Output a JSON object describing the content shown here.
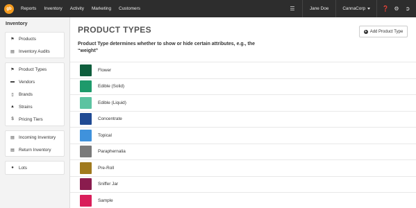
{
  "topnav": {
    "logo_text": "gb",
    "links": [
      "Reports",
      "Inventory",
      "Activity",
      "Marketing",
      "Customers"
    ],
    "user": "Jane Doe",
    "org": "CannaCorp"
  },
  "sidebar": {
    "title": "Inventory",
    "groups": [
      [
        {
          "label": "Products",
          "icon": "tag-icon"
        },
        {
          "label": "Inventory Audits",
          "icon": "clipboard-icon"
        }
      ],
      [
        {
          "label": "Product Types",
          "icon": "tags-icon"
        },
        {
          "label": "Vendors",
          "icon": "truck-icon"
        },
        {
          "label": "Brands",
          "icon": "bookmark-icon"
        },
        {
          "label": "Strains",
          "icon": "flask-icon"
        },
        {
          "label": "Pricing Tiers",
          "icon": "dollar-icon"
        }
      ],
      [
        {
          "label": "Incoming Inventory",
          "icon": "inbox-in-icon"
        },
        {
          "label": "Return Inventory",
          "icon": "inbox-out-icon"
        }
      ],
      [
        {
          "label": "Lots",
          "icon": "globe-icon"
        }
      ]
    ]
  },
  "main": {
    "title": "PRODUCT TYPES",
    "add_button": "Add Product Type",
    "description": "Product Type determines whether to show or hide certain attributes, e.g., the “weight”",
    "types": [
      {
        "name": "Flower",
        "color": "#0e5d3c"
      },
      {
        "name": "Edible (Solid)",
        "color": "#1e9a6b"
      },
      {
        "name": "Edible (Liquid)",
        "color": "#5cc3a1"
      },
      {
        "name": "Concentrate",
        "color": "#1f4a93"
      },
      {
        "name": "Topical",
        "color": "#3f92dc"
      },
      {
        "name": "Paraphernalia",
        "color": "#7a7a7a"
      },
      {
        "name": "Pre-Roll",
        "color": "#a07a1e"
      },
      {
        "name": "Sniffer Jar",
        "color": "#8a1c4e"
      },
      {
        "name": "Sample",
        "color": "#d91e5a"
      }
    ]
  }
}
